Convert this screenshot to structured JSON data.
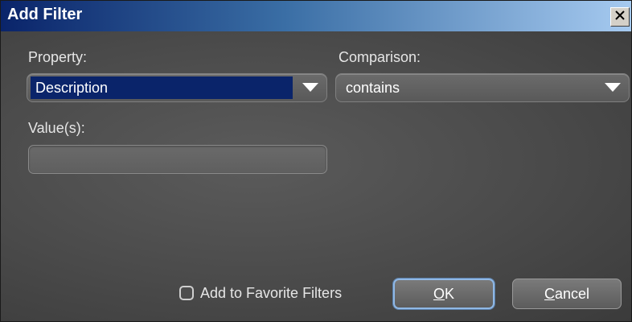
{
  "window": {
    "title": "Add Filter",
    "close_glyph": "✕"
  },
  "form": {
    "property_label": "Property:",
    "property_value": "Description",
    "comparison_label": "Comparison:",
    "comparison_value": "contains",
    "values_label": "Value(s):",
    "values_input": ""
  },
  "footer": {
    "favorite_label": "Add to Favorite Filters",
    "favorite_checked": false,
    "ok_mnemonic": "O",
    "ok_rest": "K",
    "cancel_mnemonic": "C",
    "cancel_rest": "ancel"
  },
  "colors": {
    "title_gradient_start": "#0a246a",
    "title_gradient_end": "#a6caf0",
    "panel": "#4a4a4a",
    "selection": "#0a246a",
    "default_button_border": "#8fb8e6"
  }
}
